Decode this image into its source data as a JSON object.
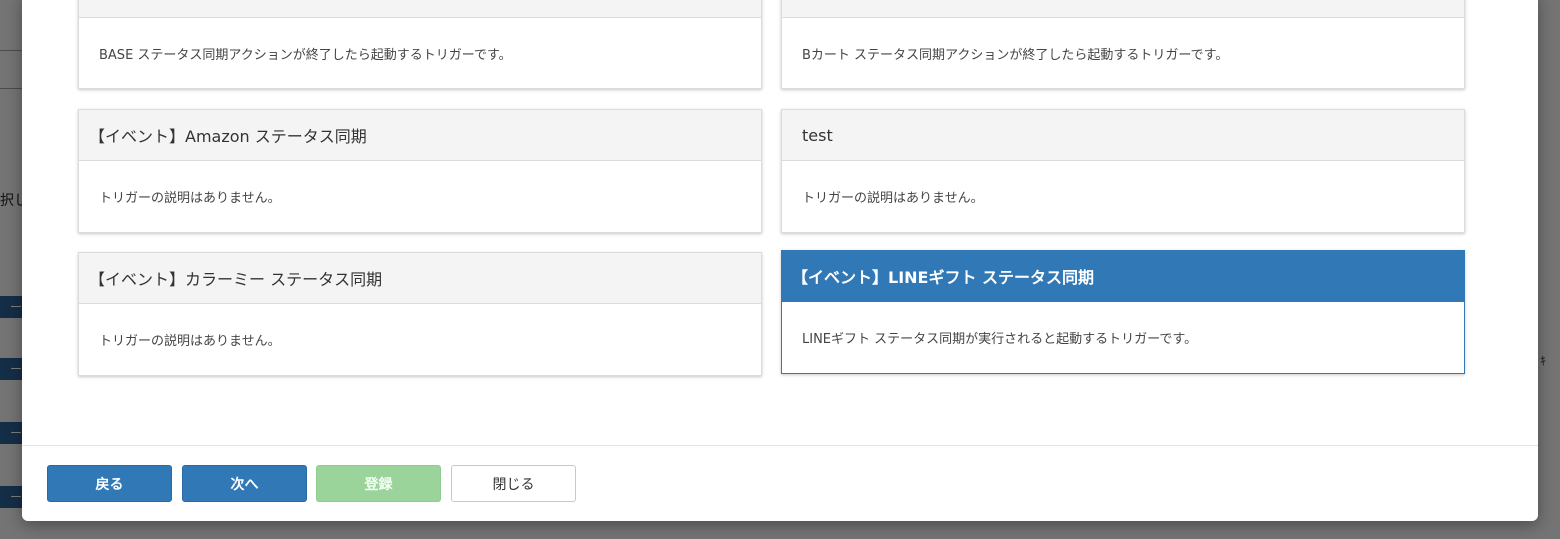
{
  "background": {
    "partial_text": "択し",
    "tag_glyph": "ー",
    "right_glyph": "ｷ"
  },
  "cards": [
    {
      "title": "",
      "description": "BASE ステータス同期アクションが終了したら起動するトリガーです。"
    },
    {
      "title": "",
      "description": "Bカート ステータス同期アクションが終了したら起動するトリガーです。"
    },
    {
      "title": "【イベント】Amazon ステータス同期",
      "description": "トリガーの説明はありません。"
    },
    {
      "title": "test",
      "description": "トリガーの説明はありません。"
    },
    {
      "title": "【イベント】カラーミー ステータス同期",
      "description": "トリガーの説明はありません。"
    },
    {
      "title": "【イベント】LINEギフト ステータス同期",
      "description": "LINEギフト ステータス同期が実行されると起動するトリガーです。",
      "selected": true
    }
  ],
  "footer": {
    "back_label": "戻る",
    "next_label": "次へ",
    "register_label": "登録",
    "close_label": "閉じる"
  },
  "colors": {
    "primary": "#3178b7",
    "success_disabled": "#9ad49a",
    "card_header": "#f4f4f4"
  }
}
